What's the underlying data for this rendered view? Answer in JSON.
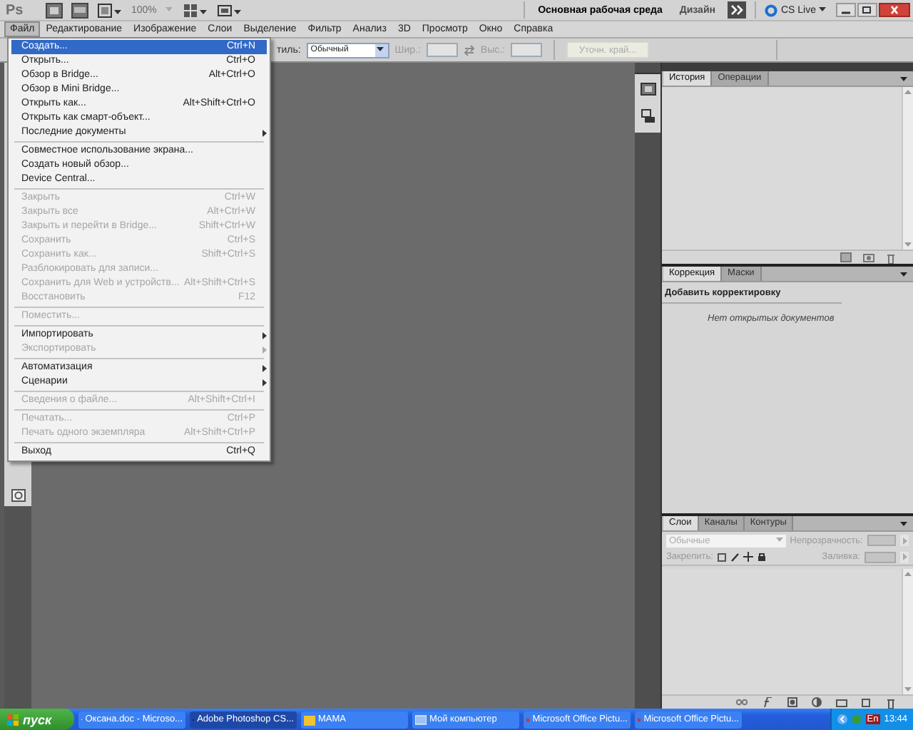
{
  "app_bar": {
    "logo": "Ps",
    "zoom": "100%",
    "workspaces": [
      {
        "label": "Основная рабочая среда",
        "selected": true
      },
      {
        "label": "Дизайн",
        "selected": false
      }
    ],
    "cs_live": "CS Live"
  },
  "menu_bar": {
    "items": [
      {
        "label": "Файл",
        "selected": true
      },
      {
        "label": "Редактирование",
        "selected": false
      },
      {
        "label": "Изображение",
        "selected": false
      },
      {
        "label": "Слои",
        "selected": false
      },
      {
        "label": "Выделение",
        "selected": false
      },
      {
        "label": "Фильтр",
        "selected": false
      },
      {
        "label": "Анализ",
        "selected": false
      },
      {
        "label": "3D",
        "selected": false
      },
      {
        "label": "Просмотр",
        "selected": false
      },
      {
        "label": "Окно",
        "selected": false
      },
      {
        "label": "Справка",
        "selected": false
      }
    ]
  },
  "options_bar": {
    "style_label": "тиль:",
    "style_value": "Обычный",
    "width_label": "Шир.:",
    "height_label": "Выс.:",
    "refine_button": "Уточн. край..."
  },
  "file_menu": {
    "items": [
      {
        "kind": "item",
        "label": "Создать...",
        "shortcut": "Ctrl+N",
        "selected": true,
        "disabled": false,
        "submenu": false
      },
      {
        "kind": "item",
        "label": "Открыть...",
        "shortcut": "Ctrl+O",
        "selected": false,
        "disabled": false,
        "submenu": false
      },
      {
        "kind": "item",
        "label": "Обзор в Bridge...",
        "shortcut": "Alt+Ctrl+O",
        "selected": false,
        "disabled": false,
        "submenu": false
      },
      {
        "kind": "item",
        "label": "Обзор в Mini Bridge...",
        "selected": false,
        "disabled": false,
        "submenu": false
      },
      {
        "kind": "item",
        "label": "Открыть как...",
        "shortcut": "Alt+Shift+Ctrl+O",
        "selected": false,
        "disabled": false,
        "submenu": false
      },
      {
        "kind": "item",
        "label": "Открыть как смарт-объект...",
        "selected": false,
        "disabled": false,
        "submenu": false
      },
      {
        "kind": "item",
        "label": "Последние документы",
        "selected": false,
        "disabled": false,
        "submenu": true
      },
      {
        "kind": "separator"
      },
      {
        "kind": "item",
        "label": "Совместное использование экрана...",
        "selected": false,
        "disabled": false,
        "submenu": false
      },
      {
        "kind": "item",
        "label": "Создать новый обзор...",
        "selected": false,
        "disabled": false,
        "submenu": false
      },
      {
        "kind": "item",
        "label": "Device Central...",
        "selected": false,
        "disabled": false,
        "submenu": false
      },
      {
        "kind": "separator"
      },
      {
        "kind": "item",
        "label": "Закрыть",
        "shortcut": "Ctrl+W",
        "selected": false,
        "disabled": true,
        "submenu": false
      },
      {
        "kind": "item",
        "label": "Закрыть все",
        "shortcut": "Alt+Ctrl+W",
        "selected": false,
        "disabled": true,
        "submenu": false
      },
      {
        "kind": "item",
        "label": "Закрыть и перейти в Bridge...",
        "shortcut": "Shift+Ctrl+W",
        "selected": false,
        "disabled": true,
        "submenu": false
      },
      {
        "kind": "item",
        "label": "Сохранить",
        "shortcut": "Ctrl+S",
        "selected": false,
        "disabled": true,
        "submenu": false
      },
      {
        "kind": "item",
        "label": "Сохранить как...",
        "shortcut": "Shift+Ctrl+S",
        "selected": false,
        "disabled": true,
        "submenu": false
      },
      {
        "kind": "item",
        "label": "Разблокировать для записи...",
        "selected": false,
        "disabled": true,
        "submenu": false
      },
      {
        "kind": "item",
        "label": "Сохранить для Web и устройств...",
        "shortcut": "Alt+Shift+Ctrl+S",
        "selected": false,
        "disabled": true,
        "submenu": false
      },
      {
        "kind": "item",
        "label": "Восстановить",
        "shortcut": "F12",
        "selected": false,
        "disabled": true,
        "submenu": false
      },
      {
        "kind": "separator"
      },
      {
        "kind": "item",
        "label": "Поместить...",
        "selected": false,
        "disabled": true,
        "submenu": false
      },
      {
        "kind": "separator"
      },
      {
        "kind": "item",
        "label": "Импортировать",
        "selected": false,
        "disabled": false,
        "submenu": true
      },
      {
        "kind": "item",
        "label": "Экспортировать",
        "selected": false,
        "disabled": true,
        "submenu": true
      },
      {
        "kind": "separator"
      },
      {
        "kind": "item",
        "label": "Автоматизация",
        "selected": false,
        "disabled": false,
        "submenu": true
      },
      {
        "kind": "item",
        "label": "Сценарии",
        "selected": false,
        "disabled": false,
        "submenu": true
      },
      {
        "kind": "separator"
      },
      {
        "kind": "item",
        "label": "Сведения о файле...",
        "shortcut": "Alt+Shift+Ctrl+I",
        "selected": false,
        "disabled": true,
        "submenu": false
      },
      {
        "kind": "separator"
      },
      {
        "kind": "item",
        "label": "Печатать...",
        "shortcut": "Ctrl+P",
        "selected": false,
        "disabled": true,
        "submenu": false
      },
      {
        "kind": "item",
        "label": "Печать одного экземпляра",
        "shortcut": "Alt+Shift+Ctrl+P",
        "selected": false,
        "disabled": true,
        "submenu": false
      },
      {
        "kind": "separator"
      },
      {
        "kind": "item",
        "label": "Выход",
        "shortcut": "Ctrl+Q",
        "selected": false,
        "disabled": false,
        "submenu": false
      }
    ]
  },
  "history_panel": {
    "tabs": [
      {
        "label": "История",
        "selected": true
      },
      {
        "label": "Операции",
        "selected": false
      }
    ]
  },
  "adjustments_panel": {
    "tabs": [
      {
        "label": "Коррекция",
        "selected": true
      },
      {
        "label": "Маски",
        "selected": false
      }
    ],
    "heading": "Добавить корректировку",
    "message": "Нет открытых документов"
  },
  "layers_panel": {
    "tabs": [
      {
        "label": "Слои",
        "selected": true
      },
      {
        "label": "Каналы",
        "selected": false
      },
      {
        "label": "Контуры",
        "selected": false
      }
    ],
    "blend_mode": "Обычные",
    "opacity_label": "Непрозрачность:",
    "lock_label": "Закрепить:",
    "fill_label": "Заливка:"
  },
  "taskbar": {
    "start": "пуск",
    "tasks": [
      {
        "label": "Оксана.doc - Microso...",
        "selected": false
      },
      {
        "label": "Adobe Photoshop CS...",
        "selected": true
      },
      {
        "label": "МАМА",
        "selected": false
      },
      {
        "label": "Мой компьютер",
        "selected": false
      },
      {
        "label": "Microsoft Office Pictu...",
        "selected": false
      },
      {
        "label": "Microsoft Office Pictu...",
        "selected": false
      }
    ],
    "language": "En",
    "clock": "13:44"
  }
}
